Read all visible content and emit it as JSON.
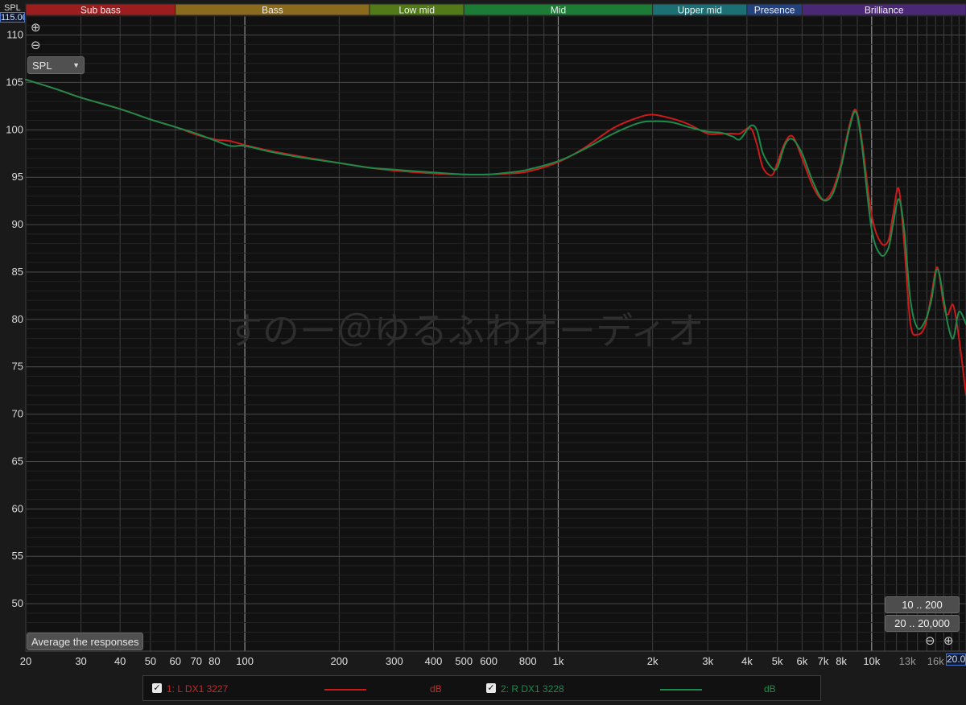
{
  "header": {
    "axis_name": "SPL",
    "max_value": "115.00"
  },
  "bands": [
    {
      "name": "Sub bass",
      "f0": 20,
      "f1": 60,
      "color": "#9b1d1d"
    },
    {
      "name": "Bass",
      "f0": 60,
      "f1": 250,
      "color": "#8a6a1c"
    },
    {
      "name": "Low mid",
      "f0": 250,
      "f1": 500,
      "color": "#527a18"
    },
    {
      "name": "Mid",
      "f0": 500,
      "f1": 2000,
      "color": "#1c7c35"
    },
    {
      "name": "Upper mid",
      "f0": 2000,
      "f1": 4000,
      "color": "#1c6f72"
    },
    {
      "name": "Presence",
      "f0": 4000,
      "f1": 6000,
      "color": "#24427e"
    },
    {
      "name": "Brilliance",
      "f0": 6000,
      "f1": 20000,
      "color": "#4b2875"
    }
  ],
  "controls": {
    "dropdown_value": "SPL",
    "average_label": "Average the responses",
    "range_buttons": [
      "10 .. 200",
      "20 .. 20,000"
    ],
    "zoom_in_icon": "zoom-in-icon",
    "zoom_out_icon": "zoom-out-icon",
    "fmax_value": "20.00"
  },
  "watermark": "すのー＠ゆるふわオーディオ",
  "legend": [
    {
      "label": "1: L DX1 3227",
      "unit": "dB",
      "color": "#cc1a1a",
      "checked": true
    },
    {
      "label": "2: R DX1 3228",
      "unit": "dB",
      "color": "#1e8a4a",
      "checked": true
    }
  ],
  "chart_data": {
    "type": "line",
    "title": "",
    "xlabel": "",
    "ylabel": "SPL",
    "x_scale": "log",
    "xlim": [
      20,
      20000
    ],
    "ylim": [
      45,
      112
    ],
    "grid": true,
    "y_ticks": [
      50,
      55,
      60,
      65,
      70,
      75,
      80,
      85,
      90,
      95,
      100,
      105,
      110
    ],
    "x_ticks": [
      {
        "v": 20,
        "label": "20"
      },
      {
        "v": 30,
        "label": "30"
      },
      {
        "v": 40,
        "label": "40"
      },
      {
        "v": 50,
        "label": "50"
      },
      {
        "v": 60,
        "label": "60"
      },
      {
        "v": 70,
        "label": "70"
      },
      {
        "v": 80,
        "label": "80"
      },
      {
        "v": 100,
        "label": "100"
      },
      {
        "v": 200,
        "label": "200"
      },
      {
        "v": 300,
        "label": "300"
      },
      {
        "v": 400,
        "label": "400"
      },
      {
        "v": 500,
        "label": "500"
      },
      {
        "v": 600,
        "label": "600"
      },
      {
        "v": 800,
        "label": "800"
      },
      {
        "v": 1000,
        "label": "1k"
      },
      {
        "v": 2000,
        "label": "2k"
      },
      {
        "v": 3000,
        "label": "3k"
      },
      {
        "v": 4000,
        "label": "4k"
      },
      {
        "v": 5000,
        "label": "5k"
      },
      {
        "v": 6000,
        "label": "6k"
      },
      {
        "v": 7000,
        "label": "7k"
      },
      {
        "v": 8000,
        "label": "8k"
      },
      {
        "v": 10000,
        "label": "10k"
      },
      {
        "v": 13000,
        "label": "13k"
      },
      {
        "v": 16000,
        "label": "16k"
      }
    ],
    "series": [
      {
        "name": "1: L DX1 3227",
        "color": "#cc1a1a",
        "x": [
          20,
          25,
          30,
          40,
          50,
          60,
          70,
          80,
          90,
          100,
          120,
          150,
          200,
          250,
          300,
          400,
          500,
          600,
          700,
          800,
          1000,
          1200,
          1500,
          1800,
          2000,
          2300,
          2600,
          3000,
          3300,
          3600,
          3800,
          4100,
          4300,
          4500,
          4800,
          5000,
          5300,
          5600,
          6000,
          6500,
          7000,
          7500,
          8000,
          8500,
          8900,
          9300,
          10000,
          10700,
          11300,
          11700,
          12200,
          12700,
          13300,
          14000,
          14800,
          15500,
          16200,
          17000,
          17500,
          18200,
          19000,
          20000
        ],
        "y": [
          105.3,
          104.3,
          103.4,
          102.2,
          101.1,
          100.3,
          99.5,
          99.0,
          98.8,
          98.4,
          97.8,
          97.2,
          96.5,
          96.0,
          95.7,
          95.4,
          95.3,
          95.3,
          95.4,
          95.6,
          96.6,
          98.0,
          100.2,
          101.3,
          101.6,
          101.2,
          100.6,
          99.6,
          99.6,
          99.6,
          99.6,
          100.2,
          98.5,
          96.0,
          95.2,
          96.5,
          98.7,
          99.3,
          97.0,
          94.0,
          92.6,
          93.6,
          96.5,
          100.5,
          102.1,
          99.0,
          91.0,
          88.1,
          88.3,
          91.0,
          93.8,
          88.0,
          79.5,
          78.4,
          79.3,
          82.5,
          85.5,
          81.4,
          80.5,
          81.5,
          78.0,
          72.0
        ]
      },
      {
        "name": "2: R DX1 3228",
        "color": "#1e8a4a",
        "x": [
          20,
          25,
          30,
          40,
          50,
          60,
          70,
          80,
          90,
          100,
          120,
          150,
          200,
          250,
          300,
          400,
          500,
          600,
          700,
          800,
          1000,
          1200,
          1500,
          1800,
          2000,
          2300,
          2600,
          3000,
          3300,
          3600,
          3800,
          4100,
          4300,
          4500,
          4800,
          5000,
          5300,
          5600,
          6000,
          6500,
          7000,
          7500,
          8000,
          8500,
          8900,
          9300,
          10000,
          10700,
          11300,
          11700,
          12200,
          12700,
          13300,
          14000,
          14800,
          15500,
          16200,
          17000,
          17500,
          18200,
          19000,
          20000
        ],
        "y": [
          105.3,
          104.3,
          103.4,
          102.2,
          101.1,
          100.3,
          99.6,
          98.9,
          98.3,
          98.3,
          97.7,
          97.1,
          96.5,
          96.0,
          95.8,
          95.5,
          95.3,
          95.3,
          95.5,
          95.8,
          96.7,
          97.9,
          99.6,
          100.7,
          100.9,
          100.8,
          100.3,
          99.8,
          99.7,
          99.3,
          99.0,
          100.4,
          100.0,
          97.5,
          96.0,
          96.0,
          98.5,
          99.0,
          97.5,
          94.5,
          92.6,
          93.2,
          96.2,
          100.2,
          101.9,
          98.5,
          89.5,
          86.8,
          87.5,
          90.0,
          92.7,
          89.5,
          82.0,
          79.1,
          79.8,
          82.0,
          85.3,
          82.0,
          79.5,
          78.0,
          80.8,
          79.5
        ]
      }
    ]
  }
}
